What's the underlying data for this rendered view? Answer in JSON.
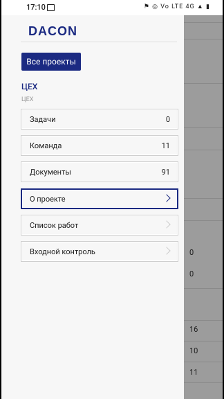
{
  "status": {
    "time": "17:10",
    "right_icons": "⚑ ◎ Vo LTE 4G ▲ ▮"
  },
  "background": {
    "numbers": [
      "0",
      "0",
      "16",
      "10",
      "11"
    ]
  },
  "drawer": {
    "brand": "DACON",
    "all_projects": "Все проекты",
    "section_title": "ЦЕХ",
    "section_sub": "ЦЕХ",
    "items": [
      {
        "label": "Задачи",
        "count": "0"
      },
      {
        "label": "Команда",
        "count": "11"
      },
      {
        "label": "Документы",
        "count": "91"
      },
      {
        "label": "О проекте",
        "icon": "chevron-right-icon",
        "active": true
      },
      {
        "label": "Список работ",
        "icon": "chevron-right-icon"
      },
      {
        "label": "Входной контроль",
        "icon": "chevron-right-icon"
      }
    ]
  }
}
